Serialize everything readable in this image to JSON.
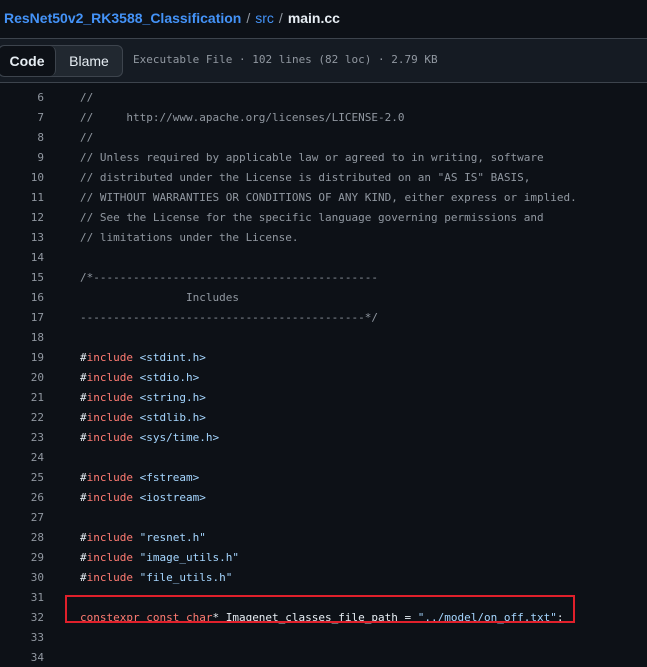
{
  "breadcrumb": {
    "repo": "ResNet50v2_RK3588_Classification",
    "sep1": "/",
    "dir": "src",
    "sep2": "/",
    "file": "main.cc"
  },
  "toolbar": {
    "code_label": "Code",
    "blame_label": "Blame",
    "file_info": "Executable File · 102 lines (82 loc) · 2.79 KB"
  },
  "code": {
    "lines": [
      {
        "n": "6",
        "tokens": [
          {
            "t": "//",
            "c": "comment"
          }
        ]
      },
      {
        "n": "7",
        "tokens": [
          {
            "t": "//     http://www.apache.org/licenses/LICENSE-2.0",
            "c": "comment"
          }
        ]
      },
      {
        "n": "8",
        "tokens": [
          {
            "t": "//",
            "c": "comment"
          }
        ]
      },
      {
        "n": "9",
        "tokens": [
          {
            "t": "// Unless required by applicable law or agreed to in writing, software",
            "c": "comment"
          }
        ]
      },
      {
        "n": "10",
        "tokens": [
          {
            "t": "// distributed under the License is distributed on an \"AS IS\" BASIS,",
            "c": "comment"
          }
        ]
      },
      {
        "n": "11",
        "tokens": [
          {
            "t": "// WITHOUT WARRANTIES OR CONDITIONS OF ANY KIND, either express or implied.",
            "c": "comment"
          }
        ]
      },
      {
        "n": "12",
        "tokens": [
          {
            "t": "// See the License for the specific language governing permissions and",
            "c": "comment"
          }
        ]
      },
      {
        "n": "13",
        "tokens": [
          {
            "t": "// limitations under the License.",
            "c": "comment"
          }
        ]
      },
      {
        "n": "14",
        "tokens": []
      },
      {
        "n": "15",
        "tokens": [
          {
            "t": "/*-------------------------------------------",
            "c": "comment"
          }
        ]
      },
      {
        "n": "16",
        "tokens": [
          {
            "t": "                Includes",
            "c": "comment"
          }
        ]
      },
      {
        "n": "17",
        "tokens": [
          {
            "t": "-------------------------------------------*/",
            "c": "comment"
          }
        ]
      },
      {
        "n": "18",
        "tokens": []
      },
      {
        "n": "19",
        "tokens": [
          {
            "t": "#",
            "c": "plain"
          },
          {
            "t": "include",
            "c": "kw"
          },
          {
            "t": " <stdint.h>",
            "c": "str"
          }
        ]
      },
      {
        "n": "20",
        "tokens": [
          {
            "t": "#",
            "c": "plain"
          },
          {
            "t": "include",
            "c": "kw"
          },
          {
            "t": " <stdio.h>",
            "c": "str"
          }
        ]
      },
      {
        "n": "21",
        "tokens": [
          {
            "t": "#",
            "c": "plain"
          },
          {
            "t": "include",
            "c": "kw"
          },
          {
            "t": " <string.h>",
            "c": "str"
          }
        ]
      },
      {
        "n": "22",
        "tokens": [
          {
            "t": "#",
            "c": "plain"
          },
          {
            "t": "include",
            "c": "kw"
          },
          {
            "t": " <stdlib.h>",
            "c": "str"
          }
        ]
      },
      {
        "n": "23",
        "tokens": [
          {
            "t": "#",
            "c": "plain"
          },
          {
            "t": "include",
            "c": "kw"
          },
          {
            "t": " <sys/time.h>",
            "c": "str"
          }
        ]
      },
      {
        "n": "24",
        "tokens": []
      },
      {
        "n": "25",
        "tokens": [
          {
            "t": "#",
            "c": "plain"
          },
          {
            "t": "include",
            "c": "kw"
          },
          {
            "t": " <fstream>",
            "c": "str"
          }
        ]
      },
      {
        "n": "26",
        "tokens": [
          {
            "t": "#",
            "c": "plain"
          },
          {
            "t": "include",
            "c": "kw"
          },
          {
            "t": " <iostream>",
            "c": "str"
          }
        ]
      },
      {
        "n": "27",
        "tokens": []
      },
      {
        "n": "28",
        "tokens": [
          {
            "t": "#",
            "c": "plain"
          },
          {
            "t": "include",
            "c": "kw"
          },
          {
            "t": " \"resnet.h\"",
            "c": "str"
          }
        ]
      },
      {
        "n": "29",
        "tokens": [
          {
            "t": "#",
            "c": "plain"
          },
          {
            "t": "include",
            "c": "kw"
          },
          {
            "t": " \"image_utils.h\"",
            "c": "str"
          }
        ]
      },
      {
        "n": "30",
        "tokens": [
          {
            "t": "#",
            "c": "plain"
          },
          {
            "t": "include",
            "c": "kw"
          },
          {
            "t": " \"file_utils.h\"",
            "c": "str"
          }
        ]
      },
      {
        "n": "31",
        "tokens": []
      },
      {
        "n": "32",
        "tokens": [
          {
            "t": "constexpr const char",
            "c": "kw"
          },
          {
            "t": "* Imagenet_classes_file_path = ",
            "c": "plain"
          },
          {
            "t": "\"../model/on_off.txt\"",
            "c": "str"
          },
          {
            "t": ";",
            "c": "plain"
          }
        ]
      },
      {
        "n": "33",
        "tokens": []
      },
      {
        "n": "34",
        "tokens": []
      }
    ]
  },
  "colors": {
    "background": "#0d1117",
    "link": "#4493f8",
    "highlight_box": "#e0202b"
  }
}
